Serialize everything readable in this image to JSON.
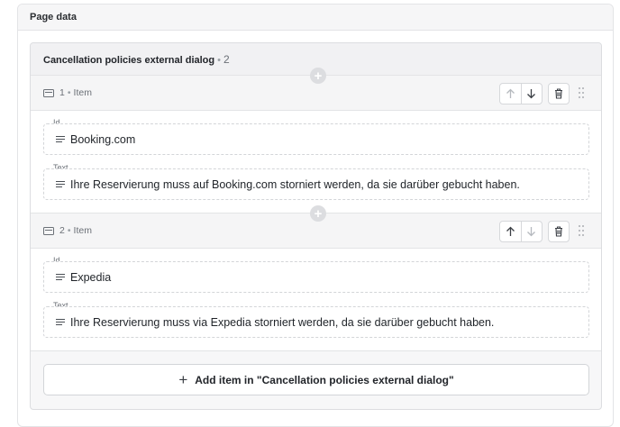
{
  "panel": {
    "title": "Page data"
  },
  "group": {
    "title": "Cancellation policies external dialog",
    "separator": "•",
    "count": "2",
    "items": [
      {
        "index": "1",
        "separator": "•",
        "label": "Item",
        "fields": [
          {
            "label": "Id",
            "value": "Booking.com"
          },
          {
            "label": "Text",
            "value": "Ihre Reservierung muss auf Booking.com storniert werden, da sie darüber gebucht haben."
          }
        ]
      },
      {
        "index": "2",
        "separator": "•",
        "label": "Item",
        "fields": [
          {
            "label": "Id",
            "value": "Expedia"
          },
          {
            "label": "Text",
            "value": "Ihre Reservierung muss via Expedia storniert werden, da sie darüber gebucht haben."
          }
        ]
      }
    ],
    "add_button_label": "Add item in \"Cancellation policies external dialog\""
  }
}
